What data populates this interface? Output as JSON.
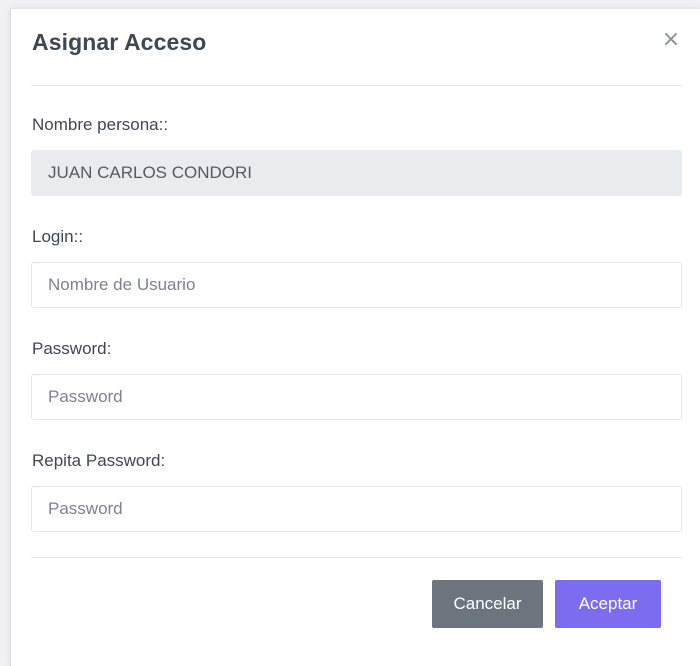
{
  "modal": {
    "title": "Asignar Acceso",
    "close_symbol": "×"
  },
  "form": {
    "nombre": {
      "label": "Nombre persona::",
      "value": "JUAN CARLOS CONDORI"
    },
    "login": {
      "label": "Login::",
      "value": "",
      "placeholder": "Nombre de Usuario"
    },
    "password": {
      "label": "Password:",
      "value": "",
      "placeholder": "Password"
    },
    "repeat_password": {
      "label": "Repita Password:",
      "value": "",
      "placeholder": "Password"
    }
  },
  "footer": {
    "cancel_label": "Cancelar",
    "accept_label": "Aceptar"
  },
  "colors": {
    "title_text": "#3d4852",
    "readonly_bg": "#e9ecef",
    "cancel_button": "#6c757d",
    "accept_button": "#7c6df0"
  }
}
